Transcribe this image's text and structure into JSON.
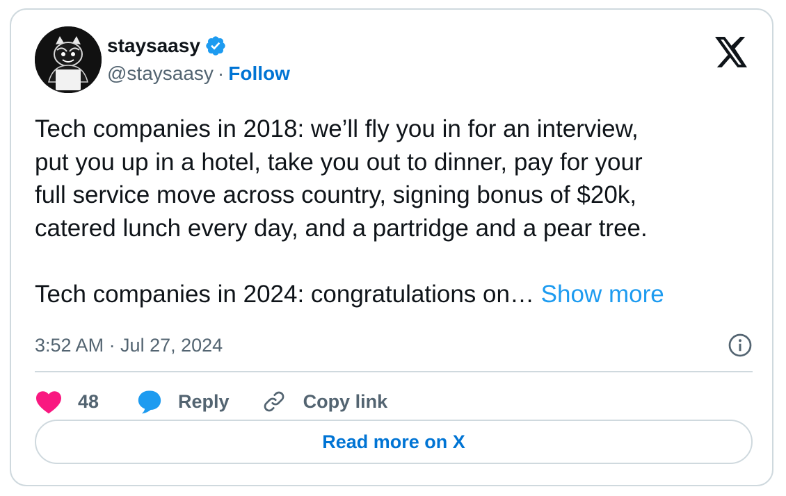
{
  "author": {
    "display_name": "staysaasy",
    "handle": "@staysaasy",
    "separator": "·",
    "follow_label": "Follow",
    "verified": true,
    "verified_color": "#1d9bf0",
    "avatar_icon": "bear-mascot-avatar"
  },
  "tweet": {
    "text": "Tech companies in 2018: we’ll fly you in for an interview,\nput you up in a hotel, take you out to dinner, pay for your\nfull service move across country, signing bonus of $20k,\ncatered lunch every day, and a partridge and a pear tree.\n\nTech companies in 2024: congratulations on… ",
    "show_more_label": "Show more"
  },
  "meta": {
    "timestamp": "3:52 AM · Jul 27, 2024",
    "info_icon": "info-icon"
  },
  "actions": {
    "like_count": "48",
    "like_color": "#f91880",
    "reply_label": "Reply",
    "reply_color": "#1d9bf0",
    "copy_link_label": "Copy link"
  },
  "footer": {
    "read_more_label": "Read more on X"
  },
  "brand": {
    "logo_icon": "x-logo-icon",
    "accent": "#0074d4",
    "link": "#1d9bf0",
    "border": "#cfd9de",
    "muted_text": "#536471"
  }
}
